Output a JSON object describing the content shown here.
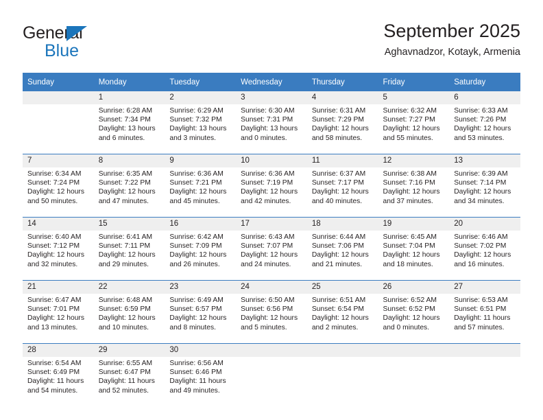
{
  "brand": {
    "name_top": "General",
    "name_bottom": "Blue",
    "accent_color": "#1b75bb"
  },
  "header": {
    "title": "September 2025",
    "subtitle": "Aghavnadzor, Kotayk, Armenia"
  },
  "theme": {
    "header_bg": "#3a7cc0",
    "header_text": "#ffffff",
    "daynum_bg": "#efefef",
    "body_text": "#231f20"
  },
  "weekdays": [
    "Sunday",
    "Monday",
    "Tuesday",
    "Wednesday",
    "Thursday",
    "Friday",
    "Saturday"
  ],
  "weeks": [
    {
      "days": [
        {
          "num": "",
          "lines": []
        },
        {
          "num": "1",
          "lines": [
            "Sunrise: 6:28 AM",
            "Sunset: 7:34 PM",
            "Daylight: 13 hours",
            "and 6 minutes."
          ]
        },
        {
          "num": "2",
          "lines": [
            "Sunrise: 6:29 AM",
            "Sunset: 7:32 PM",
            "Daylight: 13 hours",
            "and 3 minutes."
          ]
        },
        {
          "num": "3",
          "lines": [
            "Sunrise: 6:30 AM",
            "Sunset: 7:31 PM",
            "Daylight: 13 hours",
            "and 0 minutes."
          ]
        },
        {
          "num": "4",
          "lines": [
            "Sunrise: 6:31 AM",
            "Sunset: 7:29 PM",
            "Daylight: 12 hours",
            "and 58 minutes."
          ]
        },
        {
          "num": "5",
          "lines": [
            "Sunrise: 6:32 AM",
            "Sunset: 7:27 PM",
            "Daylight: 12 hours",
            "and 55 minutes."
          ]
        },
        {
          "num": "6",
          "lines": [
            "Sunrise: 6:33 AM",
            "Sunset: 7:26 PM",
            "Daylight: 12 hours",
            "and 53 minutes."
          ]
        }
      ]
    },
    {
      "days": [
        {
          "num": "7",
          "lines": [
            "Sunrise: 6:34 AM",
            "Sunset: 7:24 PM",
            "Daylight: 12 hours",
            "and 50 minutes."
          ]
        },
        {
          "num": "8",
          "lines": [
            "Sunrise: 6:35 AM",
            "Sunset: 7:22 PM",
            "Daylight: 12 hours",
            "and 47 minutes."
          ]
        },
        {
          "num": "9",
          "lines": [
            "Sunrise: 6:36 AM",
            "Sunset: 7:21 PM",
            "Daylight: 12 hours",
            "and 45 minutes."
          ]
        },
        {
          "num": "10",
          "lines": [
            "Sunrise: 6:36 AM",
            "Sunset: 7:19 PM",
            "Daylight: 12 hours",
            "and 42 minutes."
          ]
        },
        {
          "num": "11",
          "lines": [
            "Sunrise: 6:37 AM",
            "Sunset: 7:17 PM",
            "Daylight: 12 hours",
            "and 40 minutes."
          ]
        },
        {
          "num": "12",
          "lines": [
            "Sunrise: 6:38 AM",
            "Sunset: 7:16 PM",
            "Daylight: 12 hours",
            "and 37 minutes."
          ]
        },
        {
          "num": "13",
          "lines": [
            "Sunrise: 6:39 AM",
            "Sunset: 7:14 PM",
            "Daylight: 12 hours",
            "and 34 minutes."
          ]
        }
      ]
    },
    {
      "days": [
        {
          "num": "14",
          "lines": [
            "Sunrise: 6:40 AM",
            "Sunset: 7:12 PM",
            "Daylight: 12 hours",
            "and 32 minutes."
          ]
        },
        {
          "num": "15",
          "lines": [
            "Sunrise: 6:41 AM",
            "Sunset: 7:11 PM",
            "Daylight: 12 hours",
            "and 29 minutes."
          ]
        },
        {
          "num": "16",
          "lines": [
            "Sunrise: 6:42 AM",
            "Sunset: 7:09 PM",
            "Daylight: 12 hours",
            "and 26 minutes."
          ]
        },
        {
          "num": "17",
          "lines": [
            "Sunrise: 6:43 AM",
            "Sunset: 7:07 PM",
            "Daylight: 12 hours",
            "and 24 minutes."
          ]
        },
        {
          "num": "18",
          "lines": [
            "Sunrise: 6:44 AM",
            "Sunset: 7:06 PM",
            "Daylight: 12 hours",
            "and 21 minutes."
          ]
        },
        {
          "num": "19",
          "lines": [
            "Sunrise: 6:45 AM",
            "Sunset: 7:04 PM",
            "Daylight: 12 hours",
            "and 18 minutes."
          ]
        },
        {
          "num": "20",
          "lines": [
            "Sunrise: 6:46 AM",
            "Sunset: 7:02 PM",
            "Daylight: 12 hours",
            "and 16 minutes."
          ]
        }
      ]
    },
    {
      "days": [
        {
          "num": "21",
          "lines": [
            "Sunrise: 6:47 AM",
            "Sunset: 7:01 PM",
            "Daylight: 12 hours",
            "and 13 minutes."
          ]
        },
        {
          "num": "22",
          "lines": [
            "Sunrise: 6:48 AM",
            "Sunset: 6:59 PM",
            "Daylight: 12 hours",
            "and 10 minutes."
          ]
        },
        {
          "num": "23",
          "lines": [
            "Sunrise: 6:49 AM",
            "Sunset: 6:57 PM",
            "Daylight: 12 hours",
            "and 8 minutes."
          ]
        },
        {
          "num": "24",
          "lines": [
            "Sunrise: 6:50 AM",
            "Sunset: 6:56 PM",
            "Daylight: 12 hours",
            "and 5 minutes."
          ]
        },
        {
          "num": "25",
          "lines": [
            "Sunrise: 6:51 AM",
            "Sunset: 6:54 PM",
            "Daylight: 12 hours",
            "and 2 minutes."
          ]
        },
        {
          "num": "26",
          "lines": [
            "Sunrise: 6:52 AM",
            "Sunset: 6:52 PM",
            "Daylight: 12 hours",
            "and 0 minutes."
          ]
        },
        {
          "num": "27",
          "lines": [
            "Sunrise: 6:53 AM",
            "Sunset: 6:51 PM",
            "Daylight: 11 hours",
            "and 57 minutes."
          ]
        }
      ]
    },
    {
      "days": [
        {
          "num": "28",
          "lines": [
            "Sunrise: 6:54 AM",
            "Sunset: 6:49 PM",
            "Daylight: 11 hours",
            "and 54 minutes."
          ]
        },
        {
          "num": "29",
          "lines": [
            "Sunrise: 6:55 AM",
            "Sunset: 6:47 PM",
            "Daylight: 11 hours",
            "and 52 minutes."
          ]
        },
        {
          "num": "30",
          "lines": [
            "Sunrise: 6:56 AM",
            "Sunset: 6:46 PM",
            "Daylight: 11 hours",
            "and 49 minutes."
          ]
        },
        {
          "num": "",
          "lines": []
        },
        {
          "num": "",
          "lines": []
        },
        {
          "num": "",
          "lines": []
        },
        {
          "num": "",
          "lines": []
        }
      ]
    }
  ]
}
